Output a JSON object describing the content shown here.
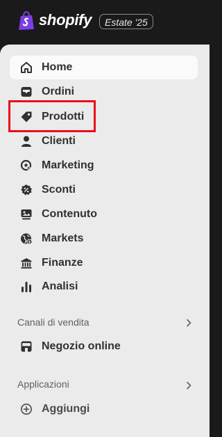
{
  "brand": {
    "name": "shopify",
    "edition": "Estate '25"
  },
  "nav": {
    "items": [
      {
        "label": "Home",
        "icon": "home-icon"
      },
      {
        "label": "Ordini",
        "icon": "orders-icon"
      },
      {
        "label": "Prodotti",
        "icon": "tag-icon"
      },
      {
        "label": "Clienti",
        "icon": "person-icon"
      },
      {
        "label": "Marketing",
        "icon": "target-icon"
      },
      {
        "label": "Sconti",
        "icon": "discount-icon"
      },
      {
        "label": "Contenuto",
        "icon": "content-icon"
      },
      {
        "label": "Markets",
        "icon": "globe-icon"
      },
      {
        "label": "Finanze",
        "icon": "bank-icon"
      },
      {
        "label": "Analisi",
        "icon": "chart-bars-icon"
      }
    ]
  },
  "sales_channels": {
    "title": "Canali di vendita",
    "items": [
      {
        "label": "Negozio online",
        "icon": "store-icon"
      }
    ]
  },
  "apps": {
    "title": "Applicazioni",
    "items": [
      {
        "label": "Aggiungi",
        "icon": "plus-circle-icon"
      }
    ]
  },
  "colors": {
    "highlight": "#e8101c",
    "brand_green": "#95bf47",
    "brand_purple": "#7b3fe4"
  }
}
